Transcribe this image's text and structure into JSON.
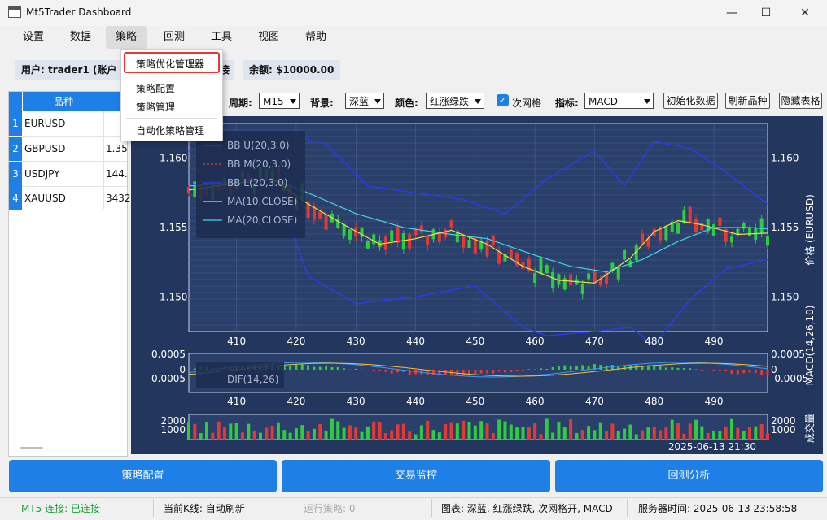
{
  "window": {
    "title": "Mt5Trader Dashboard",
    "min": "—",
    "max": "☐",
    "close": "✕"
  },
  "menu": [
    "设置",
    "数据",
    "策略",
    "回测",
    "工具",
    "视图",
    "帮助"
  ],
  "info": {
    "user": "用户: trader1 (账户",
    "conn_tail": "接",
    "balance": "余额: $10000.00"
  },
  "dropdown": [
    "策略优化管理器",
    "策略配置",
    "策略管理",
    "自动化策略管理"
  ],
  "table": {
    "header": "品种",
    "rows": [
      {
        "n": "1",
        "symbol": "EURUSD",
        "price": ""
      },
      {
        "n": "2",
        "symbol": "GBPUSD",
        "price": "1.35"
      },
      {
        "n": "3",
        "symbol": "USDJPY",
        "price": "144."
      },
      {
        "n": "4",
        "symbol": "XAUUSD",
        "price": "3432"
      }
    ]
  },
  "toolbar": {
    "period_label": "周期:",
    "period_value": "M15",
    "bg_label": "背景:",
    "bg_value": "深蓝",
    "color_label": "颜色:",
    "color_value": "红涨绿跌",
    "grid_label": "次网格",
    "indicator_label": "指标:",
    "indicator_value": "MACD",
    "btn_init": "初始化数据",
    "btn_refresh": "刷新品种",
    "btn_hide": "隐藏表格"
  },
  "buttons": {
    "config": "策略配置",
    "monitor": "交易监控",
    "backtest": "回测分析"
  },
  "status": {
    "mt5": "MT5 连接: 已连接",
    "kline": "当前K线: 自动刷新",
    "running": "运行策略: 0",
    "chart": "图表: 深蓝, 红涨绿跌, 次网格开, MACD",
    "server_time": "服务器时间: 2025-06-13 23:58:58"
  },
  "colors": {
    "accent": "#1e7fe6",
    "chart_bg": "#23365e",
    "up": "#e53935",
    "down": "#2ecc40",
    "highlight_border": "#e53935"
  },
  "chart_data": {
    "type": "line",
    "price_axis": {
      "label": "价格 (EURUSD)",
      "ticks": [
        "1.160",
        "1.155",
        "1.150"
      ],
      "ylim": [
        1.1475,
        1.1625
      ]
    },
    "x_ticks": [
      "410",
      "420",
      "430",
      "440",
      "450",
      "460",
      "470",
      "480",
      "490"
    ],
    "xlim": [
      402,
      499
    ],
    "legend": [
      "BB U(20,3.0)",
      "BB M(20,3.0)",
      "BB L(20,3.0)",
      "MA(10,CLOSE)",
      "MA(20,CLOSE)"
    ],
    "bb_upper": [
      [
        402,
        1.1605
      ],
      [
        410,
        1.1618
      ],
      [
        418,
        1.1618
      ],
      [
        425,
        1.161
      ],
      [
        432,
        1.158
      ],
      [
        440,
        1.1575
      ],
      [
        448,
        1.157
      ],
      [
        455,
        1.156
      ],
      [
        462,
        1.1585
      ],
      [
        470,
        1.1605
      ],
      [
        475,
        1.158
      ],
      [
        480,
        1.1612
      ],
      [
        486,
        1.1607
      ],
      [
        492,
        1.159
      ],
      [
        499,
        1.1567
      ]
    ],
    "bb_lower": [
      [
        402,
        1.158
      ],
      [
        410,
        1.1586
      ],
      [
        416,
        1.1585
      ],
      [
        422,
        1.1515
      ],
      [
        430,
        1.1495
      ],
      [
        440,
        1.15
      ],
      [
        450,
        1.1508
      ],
      [
        458,
        1.1478
      ],
      [
        462,
        1.1472
      ],
      [
        470,
        1.1475
      ],
      [
        476,
        1.1478
      ],
      [
        480,
        1.1465
      ],
      [
        486,
        1.1498
      ],
      [
        492,
        1.152
      ],
      [
        499,
        1.1527
      ]
    ],
    "ma10": [
      [
        402,
        1.1577
      ],
      [
        410,
        1.1582
      ],
      [
        416,
        1.1585
      ],
      [
        422,
        1.1567
      ],
      [
        428,
        1.1552
      ],
      [
        434,
        1.1538
      ],
      [
        440,
        1.1542
      ],
      [
        446,
        1.1548
      ],
      [
        452,
        1.1538
      ],
      [
        458,
        1.1522
      ],
      [
        464,
        1.1512
      ],
      [
        470,
        1.151
      ],
      [
        476,
        1.1528
      ],
      [
        480,
        1.1547
      ],
      [
        484,
        1.1555
      ],
      [
        488,
        1.1552
      ],
      [
        494,
        1.1545
      ],
      [
        499,
        1.1546
      ]
    ],
    "ma20": [
      [
        402,
        1.158
      ],
      [
        410,
        1.1582
      ],
      [
        416,
        1.1585
      ],
      [
        422,
        1.1575
      ],
      [
        430,
        1.156
      ],
      [
        438,
        1.155
      ],
      [
        446,
        1.1545
      ],
      [
        452,
        1.1542
      ],
      [
        460,
        1.153
      ],
      [
        466,
        1.1522
      ],
      [
        472,
        1.1518
      ],
      [
        478,
        1.1527
      ],
      [
        484,
        1.154
      ],
      [
        490,
        1.155
      ],
      [
        496,
        1.155
      ],
      [
        499,
        1.1549
      ]
    ],
    "macd": {
      "label": "MACD(14,26,10)",
      "ticks": [
        "0.0005",
        "0",
        "-0.0005"
      ],
      "legend": "DIF(14,26)"
    },
    "volume": {
      "label": "成交量",
      "ticks": [
        "2000",
        "1000"
      ]
    },
    "time_axis_tail": "2025-06-13 21:30"
  }
}
